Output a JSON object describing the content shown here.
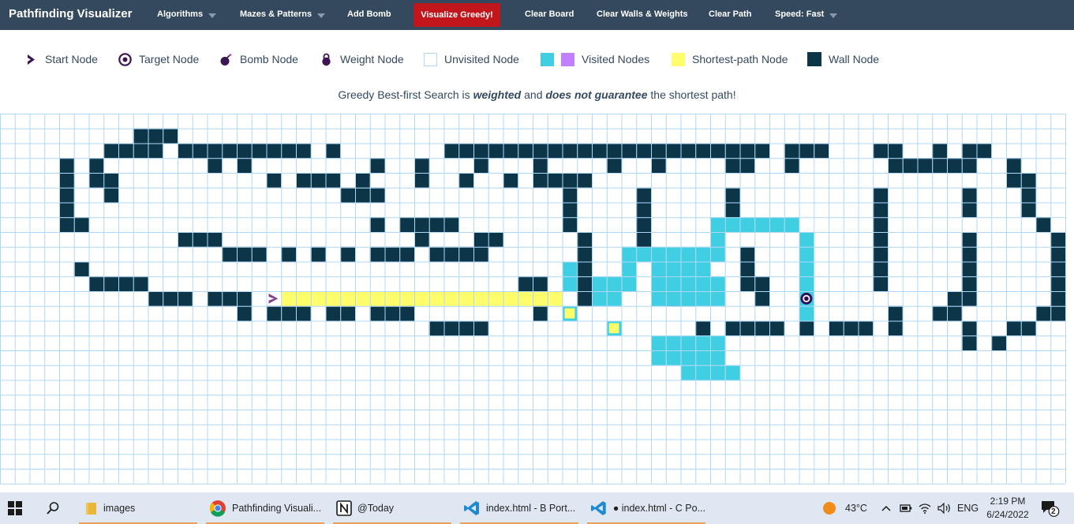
{
  "navbar": {
    "brand": "Pathfinding Visualizer",
    "algorithms": "Algorithms",
    "mazes": "Mazes & Patterns",
    "add_bomb": "Add Bomb",
    "visualize": "Visualize Greedy!",
    "clear_board": "Clear Board",
    "clear_walls": "Clear Walls & Weights",
    "clear_path": "Clear Path",
    "speed": "Speed: Fast"
  },
  "legend": {
    "start": "Start Node",
    "target": "Target Node",
    "bomb": "Bomb Node",
    "weight": "Weight Node",
    "unvisited": "Unvisited Node",
    "visited": "Visited Nodes",
    "shortest": "Shortest-path Node",
    "wall": "Wall Node"
  },
  "info": {
    "before": "Greedy Best-first Search is ",
    "weighted": "weighted",
    "mid": " and ",
    "not_guarantee": "does not guarantee",
    "after": " the shortest path!"
  },
  "colors": {
    "nav": "#34495e",
    "wall": "#0c3547",
    "visited": "#40cee3",
    "visited_alt": "#c080ff",
    "path": "#fffe6a",
    "grid_line": "#afd8f8",
    "start": "#80448c",
    "target": "#2c1057",
    "viz_btn": "#c0161c"
  },
  "grid": {
    "cols": 72,
    "rows": 25,
    "start": [
      18,
      12
    ],
    "target": [
      54,
      12
    ],
    "walls": [
      [
        3,
        2
      ],
      [
        9,
        11
      ],
      [
        12,
        13
      ],
      [
        19,
        20
      ],
      [
        14,
        20
      ],
      [
        30,
        36
      ],
      [
        37,
        51
      ],
      [
        53,
        55
      ],
      [
        59,
        60
      ],
      [
        63,
        63
      ],
      [
        65,
        66
      ],
      [
        7,
        10
      ],
      [
        12,
        15
      ],
      [
        17,
        18
      ],
      [
        20,
        20
      ],
      [
        22,
        22
      ],
      [
        25,
        25
      ],
      [
        28,
        28
      ],
      [
        32,
        32
      ],
      [
        36,
        36
      ],
      [
        41,
        41
      ],
      [
        44,
        44
      ],
      [
        49,
        50
      ],
      [
        53,
        53
      ],
      [
        60,
        62
      ],
      [
        68,
        68
      ],
      [
        6,
        6
      ],
      [
        63,
        64
      ],
      [
        14,
        14
      ],
      [
        16,
        16
      ],
      [
        65,
        65
      ],
      [
        68,
        68
      ],
      [
        4,
        4
      ],
      [
        6,
        7
      ],
      [
        18,
        18
      ],
      [
        21,
        21
      ],
      [
        24,
        24
      ],
      [
        28,
        28
      ],
      [
        68,
        68
      ],
      [
        4,
        4
      ],
      [
        7,
        7
      ],
      [
        31,
        31
      ],
      [
        34,
        34
      ],
      [
        36,
        39
      ],
      [
        69,
        69
      ],
      [
        4,
        4
      ],
      [
        7,
        7
      ],
      [
        20,
        22
      ],
      [
        38,
        38
      ],
      [
        43,
        43
      ],
      [
        49,
        49
      ],
      [
        59,
        59
      ],
      [
        65,
        65
      ],
      [
        69,
        69
      ],
      [
        4,
        4
      ],
      [
        7,
        7
      ],
      [
        23,
        25
      ],
      [
        38,
        38
      ],
      [
        43,
        43
      ],
      [
        49,
        49
      ],
      [
        59,
        59
      ],
      [
        65,
        65
      ],
      [
        69,
        69
      ],
      [
        4,
        4
      ],
      [
        38,
        38
      ],
      [
        43,
        43
      ],
      [
        49,
        49
      ],
      [
        59,
        59
      ],
      [
        65,
        65
      ],
      [
        70,
        70
      ],
      [
        4,
        4
      ],
      [
        25,
        25
      ],
      [
        30,
        30
      ],
      [
        38,
        38
      ],
      [
        43,
        43
      ],
      [
        49,
        49
      ],
      [
        59,
        59
      ],
      [
        70,
        70
      ],
      [
        5,
        5
      ],
      [
        27,
        30
      ],
      [
        32,
        32
      ],
      [
        43,
        43
      ],
      [
        59,
        59
      ],
      [
        65,
        65
      ],
      [
        71,
        71
      ],
      [
        12,
        14
      ],
      [
        28,
        28
      ],
      [
        32,
        33
      ],
      [
        39,
        39
      ],
      [
        50,
        50
      ],
      [
        59,
        59
      ],
      [
        65,
        65
      ],
      [
        71,
        71
      ],
      [
        15,
        17
      ],
      [
        19,
        19
      ],
      [
        21,
        21
      ],
      [
        23,
        23
      ],
      [
        25,
        27
      ],
      [
        29,
        32
      ],
      [
        39,
        39
      ],
      [
        44,
        44
      ],
      [
        50,
        50
      ],
      [
        59,
        59
      ],
      [
        65,
        65
      ],
      [
        71,
        71
      ],
      [
        5,
        5
      ],
      [
        39,
        39
      ],
      [
        44,
        44
      ],
      [
        50,
        50
      ],
      [
        59,
        59
      ],
      [
        71,
        71
      ],
      [
        6,
        6
      ],
      [
        35,
        36
      ],
      [
        39,
        39
      ],
      [
        44,
        45
      ],
      [
        50,
        51
      ],
      [
        59,
        59
      ],
      [
        65,
        65
      ],
      [
        71,
        71
      ],
      [
        7,
        9
      ],
      [
        36,
        36
      ],
      [
        39,
        39
      ],
      [
        45,
        45
      ],
      [
        51,
        51
      ],
      [
        64,
        65
      ],
      [
        71,
        71
      ],
      [
        10,
        12
      ],
      [
        14,
        16
      ],
      [
        36,
        36
      ],
      [
        45,
        46
      ],
      [
        63,
        64
      ],
      [
        71,
        71
      ],
      [
        16,
        16
      ],
      [
        18,
        20
      ],
      [
        22,
        22
      ],
      [
        36,
        36
      ],
      [
        60,
        60
      ],
      [
        70,
        70
      ],
      [
        23,
        23
      ],
      [
        25,
        27
      ],
      [
        29,
        29
      ],
      [
        47,
        47
      ],
      [
        49,
        52
      ],
      [
        54,
        54
      ],
      [
        56,
        58
      ],
      [
        60,
        60
      ],
      [
        69,
        69
      ],
      [
        29,
        32
      ],
      [
        65,
        65
      ],
      [
        68,
        68
      ],
      [
        65,
        65
      ],
      [
        67,
        67
      ]
    ],
    "visited": [
      [
        48,
        53
      ],
      [
        48,
        48
      ],
      [
        54,
        54
      ],
      [
        42,
        48
      ],
      [
        54,
        54
      ],
      [
        42,
        42
      ],
      [
        44,
        47
      ],
      [
        54,
        54
      ],
      [
        38,
        38
      ],
      [
        42,
        42
      ],
      [
        45,
        48
      ],
      [
        54,
        54
      ],
      [
        38,
        38
      ],
      [
        40,
        42
      ],
      [
        44,
        48
      ],
      [
        54,
        54
      ],
      [
        40,
        41
      ],
      [
        44,
        48
      ],
      [
        54,
        54
      ],
      [
        38,
        38
      ],
      [
        41,
        41
      ],
      [
        44,
        48
      ],
      [
        44,
        48
      ],
      [
        46,
        49
      ],
      [
        48,
        49
      ],
      [
        49,
        49
      ]
    ],
    "path": [
      [
        19,
        37
      ],
      [
        38,
        38
      ],
      [
        38,
        38
      ],
      [
        41,
        41
      ],
      [
        38,
        42
      ]
    ]
  },
  "taskbar": {
    "images": "images",
    "chrome": "Pathfinding Visuali...",
    "notion": "@Today",
    "vscode1": "index.html - B Port...",
    "vscode2": "● index.html - C Po...",
    "temp": "43°C",
    "lang": "ENG",
    "time": "2:19 PM",
    "date": "6/24/2022",
    "notif": "2"
  }
}
